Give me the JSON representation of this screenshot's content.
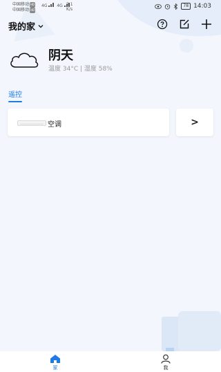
{
  "status_bar": {
    "carrier1": "中国移动",
    "carrier2": "中国移动",
    "hd": "HD",
    "signal1": "4G",
    "signal2": "4G",
    "net_speed_value": "5.1",
    "net_speed_unit": "K/s",
    "battery": "78",
    "time": "14:03"
  },
  "header": {
    "home_name": "我的家",
    "icons": [
      "help-icon",
      "edit-icon",
      "add-icon"
    ]
  },
  "weather": {
    "condition": "阴天",
    "detail": "温度 34°C | 湿度 58%"
  },
  "tabs": [
    {
      "label": "遥控"
    }
  ],
  "devices": [
    {
      "name": "空调",
      "icon": "air-conditioner-icon"
    }
  ],
  "more_arrow": ">",
  "bottom_nav": {
    "items": [
      {
        "label": "家",
        "icon": "home-icon"
      },
      {
        "label": "我",
        "icon": "user-icon"
      }
    ]
  },
  "colors": {
    "accent": "#1e7be6",
    "background": "#f3f7fd"
  }
}
